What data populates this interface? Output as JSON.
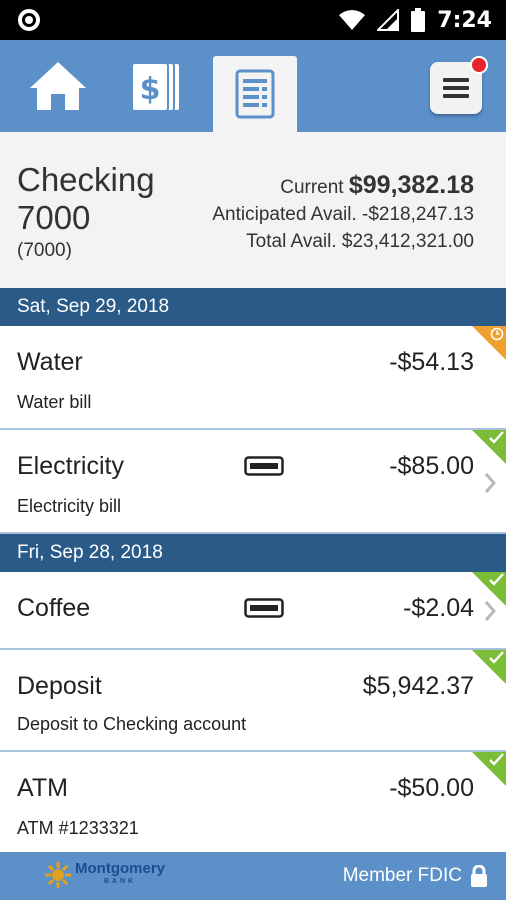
{
  "status_bar": {
    "time": "7:24"
  },
  "nav": {
    "tabs": [
      {
        "name": "home",
        "icon": "home-icon"
      },
      {
        "name": "accounts",
        "icon": "dollar-card-icon"
      },
      {
        "name": "register",
        "icon": "register-list-icon",
        "active": true
      }
    ],
    "menu_icon": "hamburger-menu-icon",
    "menu_badge_color": "#e8242c"
  },
  "account": {
    "name": "Checking 7000",
    "number": "(7000)",
    "current_label": "Current",
    "current_amount": "$99,382.18",
    "anticipated": "Anticipated Avail. -$218,247.13",
    "total": "Total Avail. $23,412,321.00"
  },
  "groups": [
    {
      "date": "Sat, Sep 29, 2018",
      "transactions": [
        {
          "title": "Water",
          "desc": "Water bill",
          "amount": "-$54.13",
          "status": "pending",
          "card": false,
          "chevron": false
        },
        {
          "title": "Electricity",
          "desc": "Electricity bill",
          "amount": "-$85.00",
          "status": "cleared",
          "card": true,
          "chevron": true
        }
      ]
    },
    {
      "date": "Fri, Sep 28, 2018",
      "transactions": [
        {
          "title": "Coffee",
          "desc": "",
          "amount": "-$2.04",
          "status": "cleared",
          "card": true,
          "chevron": true
        },
        {
          "title": "Deposit",
          "desc": "Deposit to Checking account",
          "amount": "$5,942.37",
          "status": "cleared",
          "card": false,
          "chevron": false
        },
        {
          "title": "ATM",
          "desc": "ATM #1233321",
          "amount": "-$50.00",
          "status": "cleared",
          "card": false,
          "chevron": false
        }
      ]
    }
  ],
  "footer": {
    "logo_name": "Montgomery",
    "logo_sub": "BANK",
    "member_text": "Member FDIC",
    "lock_icon": "lock-icon"
  },
  "colors": {
    "nav_blue": "#5b90c9",
    "date_header": "#2a5b88",
    "cleared": "#7cbd38",
    "pending": "#f0a030"
  }
}
